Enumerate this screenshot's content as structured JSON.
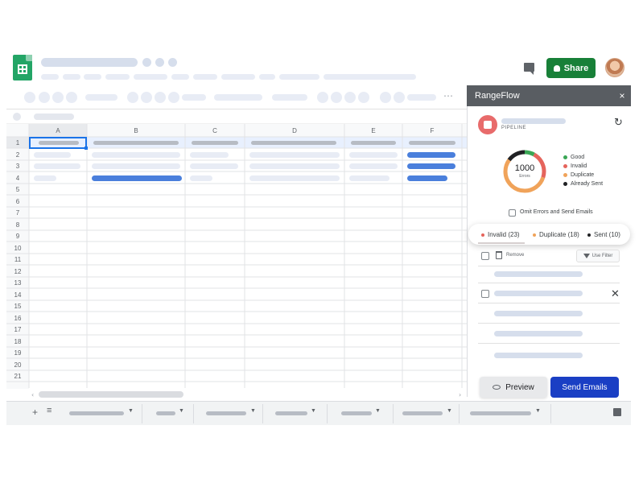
{
  "header": {
    "share_label": "Share"
  },
  "grid": {
    "columns": [
      "A",
      "B",
      "C",
      "D",
      "E",
      "F"
    ],
    "rows": [
      "1",
      "2",
      "3",
      "4",
      "5",
      "6",
      "7",
      "8",
      "9",
      "10",
      "11",
      "12",
      "13",
      "14",
      "15",
      "16",
      "17",
      "18",
      "19",
      "20",
      "21"
    ]
  },
  "panel": {
    "title": "RangeFlow",
    "close": "×",
    "pipeline_label": "PIPELINE",
    "donut": {
      "total": "1000",
      "sub_label": "Errors",
      "segments": [
        {
          "name": "Good",
          "fraction": 0.08,
          "color": "#3aa655"
        },
        {
          "name": "Invalid",
          "fraction": 0.22,
          "color": "#e5645c"
        },
        {
          "name": "Duplicate",
          "fraction": 0.55,
          "color": "#f0a35a"
        },
        {
          "name": "Already Sent",
          "fraction": 0.15,
          "color": "#202124"
        }
      ]
    },
    "legend": [
      {
        "label": "Good",
        "color": "#3aa655"
      },
      {
        "label": "Invalid",
        "color": "#e5645c"
      },
      {
        "label": "Duplicate",
        "color": "#f0a35a"
      },
      {
        "label": "Already Sent",
        "color": "#202124"
      }
    ],
    "omit_label": "Omit Errors and Send Emails",
    "filter_tabs": [
      {
        "label": "Invalid (23)",
        "color": "#e5645c"
      },
      {
        "label": "Duplicate (18)",
        "color": "#f0a35a"
      },
      {
        "label": "Sent (10)",
        "color": "#202124"
      }
    ],
    "remove_label": "Remove",
    "filter_label": "Use Filter",
    "preview_label": "Preview",
    "send_label": "Send Emails"
  }
}
